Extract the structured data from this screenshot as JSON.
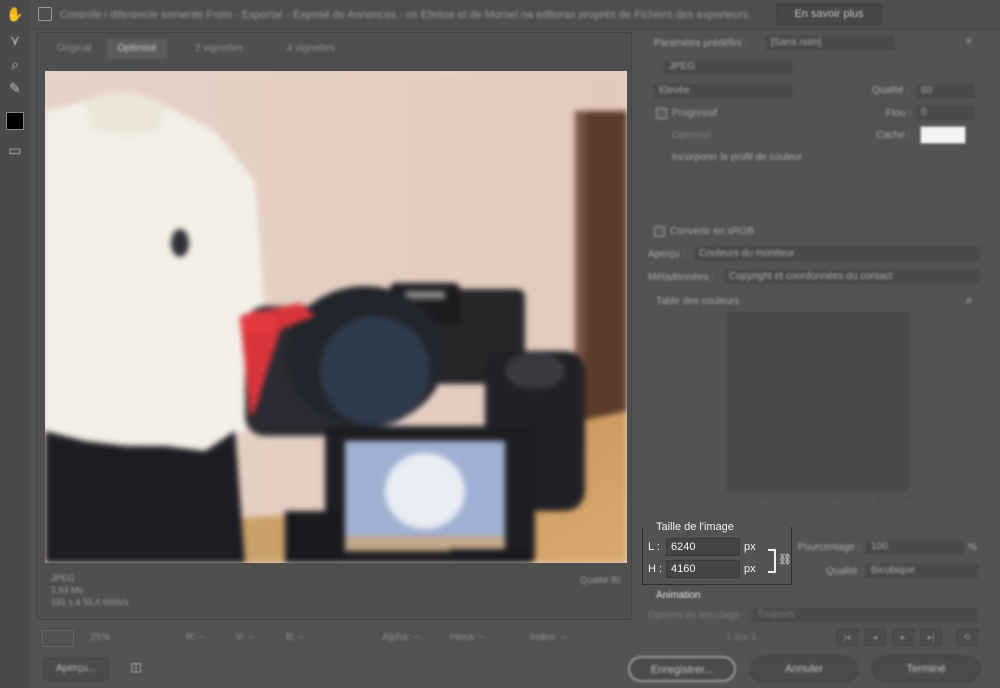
{
  "window": {
    "title": "Controle i diferencie somente Freto - Exportar - Exposé de Annonces - os Efeitos et de Morsel na editoras proprés de Fichiers des exporteurs",
    "learn_more_label": "En savoir plus"
  },
  "tools": [
    {
      "name": "hand-tool-icon",
      "glyph": "✋"
    },
    {
      "name": "slice-select-icon",
      "glyph": "⋎"
    },
    {
      "name": "zoom-tool-icon",
      "glyph": "⌕"
    },
    {
      "name": "eyedropper-icon",
      "glyph": "✎"
    },
    {
      "name": "toggle-slices-icon",
      "glyph": "▭"
    }
  ],
  "preview": {
    "tabs": [
      "Original",
      "Optimisé",
      "2 vignettes",
      "4 vignettes"
    ],
    "active_tab": 1,
    "info_left": [
      "JPEG",
      "1,63 Mo",
      "191 s à 56,6 kbits/s"
    ],
    "info_right": "Qualité 80"
  },
  "status_bar": {
    "zoom": "25%",
    "items": [
      "R: --",
      "V: --",
      "B: --",
      "Alpha: --",
      "Hexa: --",
      "Index: --"
    ]
  },
  "footer": {
    "preview_label": "Aperçu...",
    "save_label": "Enregistrer...",
    "cancel_label": "Annuler",
    "done_label": "Terminé"
  },
  "settings": {
    "preset_label": "Paramètre prédéfini :",
    "preset_value": "[Sans nom]",
    "format_value": "JPEG",
    "quality_preset": "Élevée",
    "quality_label": "Qualité :",
    "quality_value": "60",
    "progressive_label": "Progressif",
    "blur_label": "Flou :",
    "blur_value": "0",
    "optimized_label": "Optimisé",
    "matte_label": "Cache :",
    "embed_profile_label": "Incorporer le profil de couleur",
    "convert_srgb_label": "Convertir en sRGB",
    "preview_label": "Aperçu :",
    "preview_value": "Couleurs du moniteur",
    "metadata_label": "Métadonnées :",
    "metadata_value": "Copyright et coordonnées du contact",
    "color_table_label": "Table des couleurs",
    "color_table_icons": [
      "◌",
      "◌",
      "◌",
      "◌",
      "◌",
      "◌"
    ]
  },
  "image_size": {
    "title": "Taille de l'image",
    "width_label": "L :",
    "width_value": "6240",
    "height_label": "H :",
    "height_value": "4160",
    "unit": "px",
    "percent_label": "Pourcentage :",
    "percent_value": "100",
    "percent_unit": "%",
    "quality_label": "Qualité :",
    "quality_value": "Bicubique"
  },
  "animation": {
    "label": "Animation",
    "loop_label": "Options de bouclage :",
    "loop_value": "Toujours"
  },
  "frame_controls": [
    "|◂",
    "◂",
    "▸",
    "▸|",
    "⟲"
  ],
  "frame_counter": "1 sur 1"
}
